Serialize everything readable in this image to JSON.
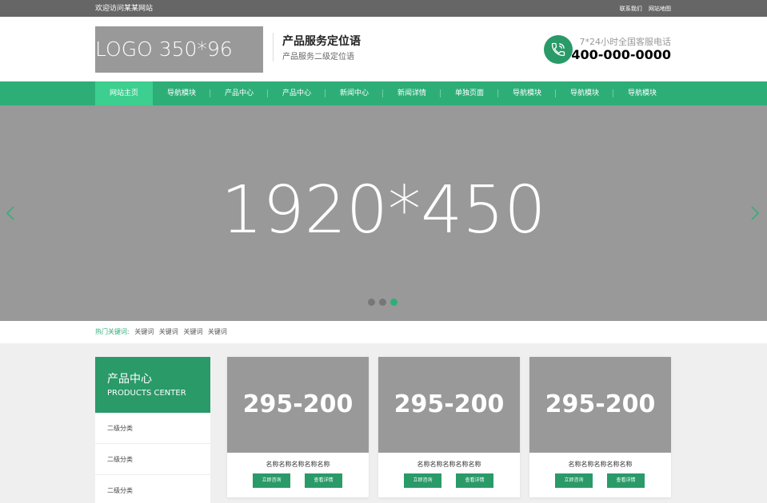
{
  "topbar": {
    "welcome": "欢迎访问某某网站",
    "links": [
      "联系我们",
      "网站地图"
    ]
  },
  "header": {
    "logo_text": "LOGO 350*96",
    "slogan_main": "产品服务定位语",
    "slogan_sub": "产品服务二级定位语",
    "hotline_label": "7*24小时全国客服电话",
    "hotline_number": "400-000-0000"
  },
  "nav": {
    "items": [
      "网站主页",
      "导航模块",
      "产品中心",
      "产品中心",
      "新闻中心",
      "新闻详情",
      "单独页面",
      "导航模块",
      "导航模块",
      "导航模块"
    ],
    "active_index": 0
  },
  "banner": {
    "text": "1920*450",
    "slide_count": 3,
    "active_slide": 3
  },
  "keywords": {
    "label": "热门关键词:",
    "items": [
      "关键词",
      "关键词",
      "关键词",
      "关键词"
    ]
  },
  "sidebar": {
    "title_cn": "产品中心",
    "title_en": "PRODUCTS CENTER",
    "items": [
      "二级分类",
      "二级分类",
      "二级分类"
    ]
  },
  "products": [
    {
      "image_text": "295-200",
      "name": "名称名称名称名称名称",
      "consult_label": "立即咨询",
      "detail_label": "查看详情"
    },
    {
      "image_text": "295-200",
      "name": "名称名称名称名称名称",
      "consult_label": "立即咨询",
      "detail_label": "查看详情"
    },
    {
      "image_text": "295-200",
      "name": "名称名称名称名称名称",
      "consult_label": "立即咨询",
      "detail_label": "查看详情"
    }
  ],
  "colors": {
    "nav_green": "#2eae77",
    "dark_green": "#2a9a68",
    "active_nav": "#3ccf8f",
    "placeholder_gray": "#999999"
  },
  "icons": {
    "phone": "phone-icon",
    "prev": "chevron-left-icon",
    "next": "chevron-right-icon"
  }
}
